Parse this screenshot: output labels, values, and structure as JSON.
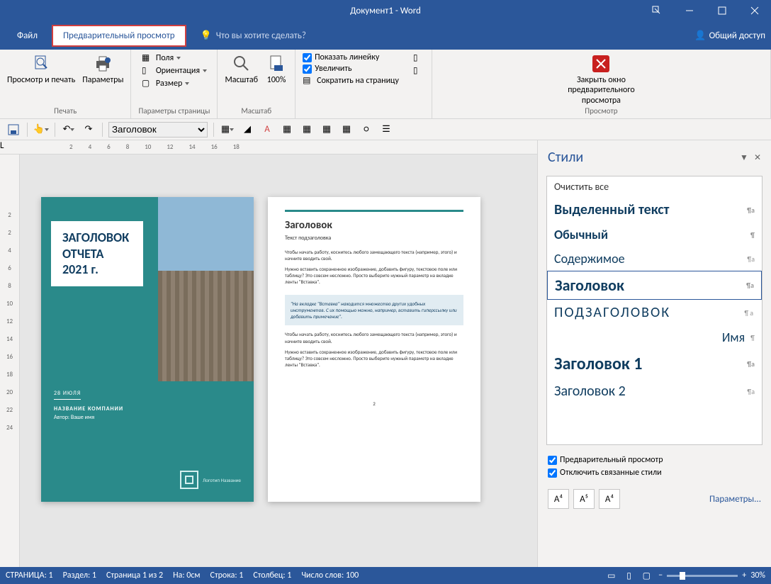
{
  "window": {
    "title": "Документ1 - Word"
  },
  "menu": {
    "file": "Файл",
    "preview_tab": "Предварительный просмотр",
    "tell_me": "Что вы хотите сделать?",
    "share": "Общий доступ"
  },
  "ribbon": {
    "print_group": "Печать",
    "print_preview": "Просмотр и печать",
    "parameters": "Параметры",
    "page_setup_group": "Параметры страницы",
    "fields": "Поля",
    "orientation": "Ориентация",
    "size": "Размер",
    "zoom_group": "Масштаб",
    "zoom": "Масштаб",
    "hundred": "100%",
    "show_ruler": "Показать линейку",
    "magnify": "Увеличить",
    "shrink": "Сократить на страницу",
    "view_group": "Просмотр",
    "close_preview": "Закрыть окно предварительного просмотра"
  },
  "qat": {
    "style_selector": "Заголовок"
  },
  "ruler_h": [
    "2",
    "4",
    "6",
    "8",
    "10",
    "12",
    "14",
    "16",
    "18"
  ],
  "ruler_v": [
    "2",
    "2",
    "4",
    "6",
    "8",
    "10",
    "12",
    "14",
    "16",
    "18",
    "20",
    "22",
    "24"
  ],
  "page1": {
    "title1": "ЗАГОЛОВОК",
    "title2": "ОТЧЕТА",
    "title3": "2021 г.",
    "date": "28 ИЮЛЯ",
    "company": "НАЗВАНИЕ КОМПАНИИ",
    "author": "Автор: Ваше имя",
    "logo_text": "Логотип Название"
  },
  "page2": {
    "heading": "Заголовок",
    "subtitle": "Текст подзаголовка",
    "p1": "Чтобы начать работу, коснитесь любого замещающего текста (например, этого) и начните вводить свой.",
    "p2": "Нужно вставить сохраненное изображение, добавить фигуру, текстовое поле или таблицу? Это совсем несложно. Просто выберите нужный параметр на вкладке ленты \"Вставка\".",
    "quote": "\"На вкладке \"Вставка\" находится множество других удобных инструментов. С их помощью можно, например, вставить гиперссылку или добавить примечание\".",
    "p3": "Чтобы начать работу, коснитесь любого замещающего текста (например, этого) и начните вводить свой.",
    "p4": "Нужно вставить сохраненное изображение, добавить фигуру, текстовое поле или таблицу? Это совсем несложно. Просто выберите нужный параметр на вкладке ленты \"Вставка\".",
    "pgnum": "2"
  },
  "styles": {
    "title": "Стили",
    "clear": "Очистить все",
    "items": {
      "highlighted": "Выделенный текст",
      "normal": "Обычный",
      "contents": "Содержимое",
      "heading": "Заголовок",
      "subheading": "ПОДЗАГОЛОВОК",
      "name": "Имя",
      "h1": "Заголовок 1",
      "h2": "Заголовок 2"
    },
    "opt_preview": "Предварительный просмотр",
    "opt_disable_linked": "Отключить связанные стили",
    "params": "Параметры..."
  },
  "status": {
    "page": "СТРАНИЦА: 1",
    "section": "Раздел: 1",
    "page_of": "Страница 1 из 2",
    "at": "На: 0см",
    "line": "Строка: 1",
    "col": "Столбец: 1",
    "words": "Число слов: 100",
    "zoom": "30%"
  }
}
